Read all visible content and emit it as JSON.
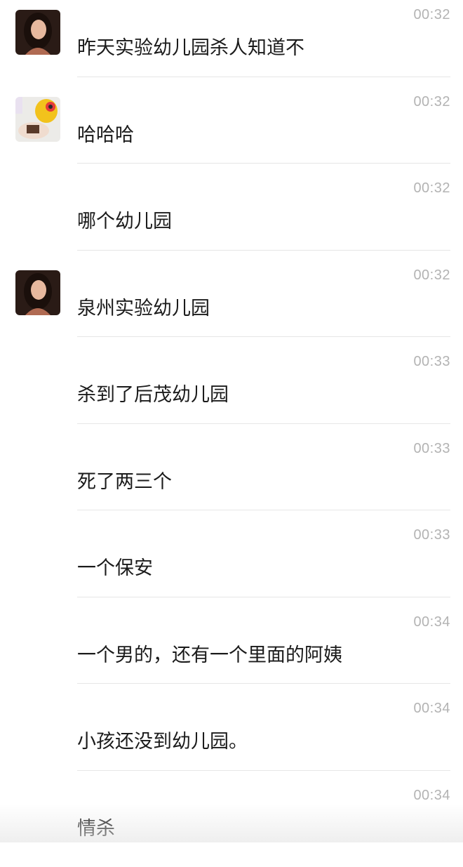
{
  "messages": [
    {
      "avatar": "woman-avatar",
      "time": "00:32",
      "text": "昨天实验幼儿园杀人知道不"
    },
    {
      "avatar": "toy-cake-avatar",
      "time": "00:32",
      "text": "哈哈哈"
    },
    {
      "avatar": "",
      "time": "00:32",
      "text": "哪个幼儿园"
    },
    {
      "avatar": "woman-avatar",
      "time": "00:32",
      "text": "泉州实验幼儿园"
    },
    {
      "avatar": "",
      "time": "00:33",
      "text": "杀到了后茂幼儿园"
    },
    {
      "avatar": "",
      "time": "00:33",
      "text": "死了两三个"
    },
    {
      "avatar": "",
      "time": "00:33",
      "text": "一个保安"
    },
    {
      "avatar": "",
      "time": "00:34",
      "text": "一个男的，还有一个里面的阿姨"
    },
    {
      "avatar": "",
      "time": "00:34",
      "text": "小孩还没到幼儿园。"
    },
    {
      "avatar": "",
      "time": "00:34",
      "text": "情杀"
    }
  ]
}
